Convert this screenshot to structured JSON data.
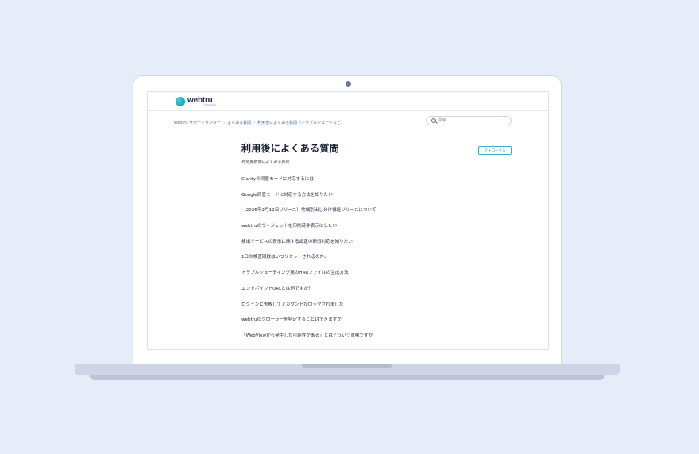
{
  "site": {
    "logo_text": "webtru",
    "logo_sub": "by DataSign"
  },
  "breadcrumb": [
    "webtru サポートセンター",
    "よくある質問",
    "利用後によくある質問（トラブルシュートなど）"
  ],
  "breadcrumb_sep": "›",
  "search": {
    "placeholder": "検索"
  },
  "section": {
    "title": "利用後によくある質問",
    "subtitle": "利用開始後によくある質問",
    "follow_label": "フォローする"
  },
  "articles": [
    "Clarityの同意モードに対応するには",
    "Google同意モードに対応する方法を知りたい",
    "（2025年2月12日リリース）地域別出し分け機能リリースについて",
    "webtruのウィジェットを印刷時非表示にしたい",
    "検出サービスの表示に関する設定の新旧対応を知りたい",
    "1日の検査回数はいつリセットされるのか。",
    "トラブルシューティング用のHARファイルの生成方法",
    "エンドポイントURLとは何ですか？",
    "ログインに失敗してアカウントがロックされました",
    "webtruのクローラーを特定することはできますか",
    "「WebViewから発生した可能性がある」とはどういう意味ですか"
  ]
}
